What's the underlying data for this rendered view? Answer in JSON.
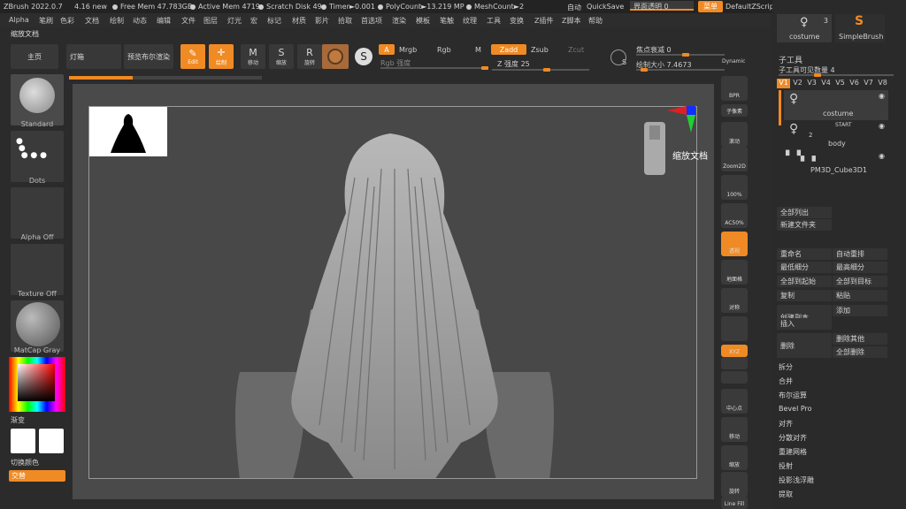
{
  "titlebar": {
    "app": "ZBrush 2022.0.7",
    "file": "4.16 new",
    "freemem": "Free Mem 47.783GB",
    "activemem": "Active Mem 4719",
    "scratch": "Scratch Disk 49",
    "timer": "Timer►0.001",
    "poly": "PolyCount►13.219 MP",
    "mesh": "MeshCount►2",
    "auto": "自动",
    "quicksave": "QuickSave",
    "transparency": "界面透明 0",
    "menu": "菜单",
    "script": "DefaultZScript"
  },
  "menu": [
    "Alpha",
    "笔刷",
    "色彩",
    "文档",
    "绘制",
    "动态",
    "编辑",
    "文件",
    "图层",
    "灯光",
    "宏",
    "标记",
    "材质",
    "影片",
    "拾取",
    "首选项",
    "渲染",
    "模板",
    "笔触",
    "纹理",
    "工具",
    "变换",
    "Z插件",
    "Z脚本",
    "帮助"
  ],
  "tooltitle": "缩放文档",
  "toolbar": {
    "home": "主页",
    "lightbox": "灯箱",
    "preview": "预览布尔渲染",
    "edit": "Edit",
    "draw": "绘制",
    "move": "移动",
    "scale": "缩放",
    "rotate": "旋转",
    "a": "A",
    "mrgb": "Mrgb",
    "rgb": "Rgb",
    "m": "M",
    "zadd": "Zadd",
    "zsub": "Zsub",
    "zcut": "Zcut",
    "rgbint": "Rgb 强度",
    "zint": "Z 强度 25",
    "focal": "焦点衰减 0",
    "drawsize": "绘制大小 7.4673",
    "dynamic": "Dynamic",
    "s": "S"
  },
  "left": {
    "standard": "Standard",
    "dots": "Dots",
    "alpha": "Alpha Off",
    "texture": "Texture Off",
    "matcap": "MatCap Gray",
    "gradient": "渐变",
    "switch": "切换颜色",
    "alternate": "交替"
  },
  "righttools": [
    "BPR",
    "子像素",
    "滚动",
    "Zoom2D",
    "100%",
    "AC50%",
    "透视",
    "地面格",
    "对称",
    "",
    "XYZ",
    "",
    "",
    "中心点",
    "移动",
    "缩放",
    "旋转",
    "Line Fill"
  ],
  "zoomtip": "缩放文档",
  "subtool": {
    "costume": "costume",
    "simplebrush": "SimpleBrush",
    "count": "3",
    "title": "子工具",
    "visible": "子工具可见数量 4",
    "versions": [
      "V1",
      "V2",
      "V3",
      "V4",
      "V5",
      "V6",
      "V7",
      "V8"
    ],
    "items": [
      "costume",
      "body",
      "PM3D_Cube3D1"
    ],
    "start": "START",
    "two": "2"
  },
  "rp_buttons": [
    "全部列出",
    "新建文件夹",
    "重命名",
    "自动重排",
    "最低细分",
    "最高细分",
    "全部到起始",
    "全部到目标",
    "复制",
    "粘贴",
    "创建副本",
    "添加",
    "插入",
    "删除",
    "删除其他",
    "全部删除"
  ],
  "rp_list": [
    "拆分",
    "合并",
    "布尔运算",
    "Bevel Pro",
    "对齐",
    "分散对齐",
    "重建网格",
    "投射",
    "投影浅浮雕",
    "提取"
  ]
}
